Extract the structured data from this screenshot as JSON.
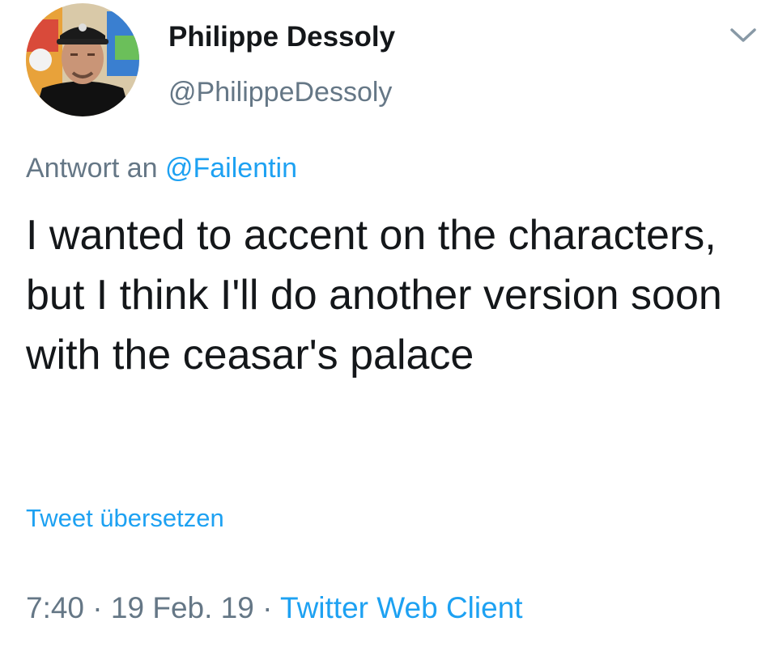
{
  "user": {
    "display_name": "Philippe Dessoly",
    "handle": "@PhilippeDessoly",
    "avatar_icon": "profile-photo"
  },
  "reply": {
    "prefix": "Antwort an",
    "mention": "@Failentin"
  },
  "tweet": {
    "text": "I wanted to accent on the characters, but I think I'll do another version soon with the ceasar's palace",
    "translate_label": "Tweet übersetzen"
  },
  "meta": {
    "time": "7:40",
    "date": "19 Feb. 19",
    "separator": " · ",
    "client": "Twitter Web Client"
  },
  "menu": {
    "caret_icon": "chevron-down-icon"
  },
  "colors": {
    "text": "#14171a",
    "secondary": "#657786",
    "link": "#1da1f2"
  }
}
